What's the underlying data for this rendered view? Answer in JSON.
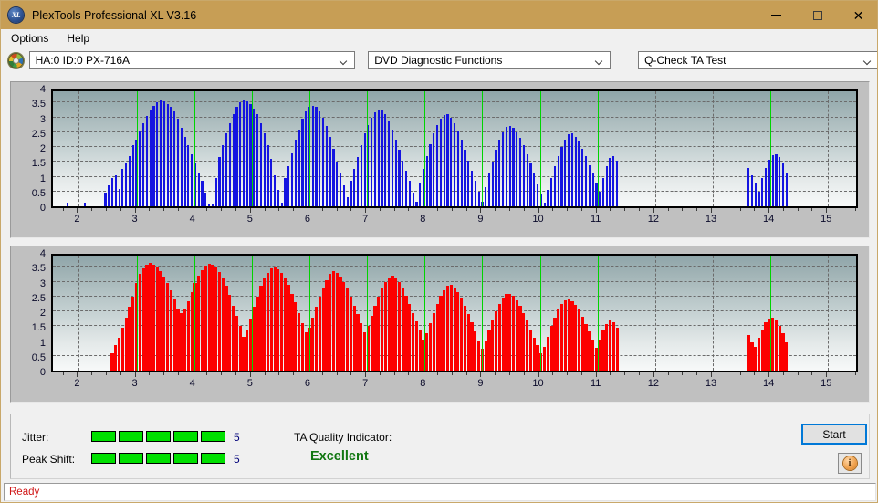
{
  "window": {
    "title": "PlexTools Professional XL V3.16",
    "icon": "xl-disc-icon",
    "icon_text": "XL",
    "controls": {
      "minimize": "minimize-icon",
      "maximize": "maximize-icon",
      "close": "close-icon"
    }
  },
  "menubar": {
    "items": [
      {
        "label": "Options"
      },
      {
        "label": "Help"
      }
    ]
  },
  "toolbar": {
    "drive_icon": "disc-icon",
    "drive_select": "HA:0 ID:0  PX-716A",
    "function_select": "DVD Diagnostic Functions",
    "test_select": "Q-Check TA Test"
  },
  "chart_data": [
    {
      "type": "bar",
      "title": "",
      "name": "ta-test-upper-blue",
      "series_color": "#1414e0",
      "background_top": "#8fa5a9",
      "background_bottom": "#f7f9f9",
      "marker_color": "#00d400",
      "grid": true,
      "legend": "none",
      "xlabel": "",
      "ylabel": "",
      "xlim": [
        1.55,
        15.55
      ],
      "ylim": [
        0,
        4
      ],
      "xticks": [
        2,
        3,
        4,
        5,
        6,
        7,
        8,
        9,
        10,
        11,
        12,
        13,
        14,
        15
      ],
      "yticks": [
        0,
        0.5,
        1,
        1.5,
        2,
        2.5,
        3,
        3.5,
        4
      ],
      "markers_x": [
        3,
        4,
        5,
        6,
        7,
        8,
        9,
        10,
        11,
        14
      ],
      "x": [
        1.8,
        1.86,
        1.92,
        1.98,
        2.04,
        2.1,
        2.16,
        2.22,
        2.28,
        2.34,
        2.4,
        2.46,
        2.52,
        2.58,
        2.64,
        2.7,
        2.76,
        2.82,
        2.88,
        2.94,
        3.0,
        3.06,
        3.12,
        3.18,
        3.24,
        3.3,
        3.36,
        3.42,
        3.48,
        3.54,
        3.6,
        3.66,
        3.72,
        3.78,
        3.84,
        3.9,
        3.96,
        4.02,
        4.08,
        4.14,
        4.2,
        4.26,
        4.32,
        4.38,
        4.44,
        4.5,
        4.56,
        4.62,
        4.68,
        4.74,
        4.8,
        4.86,
        4.92,
        4.98,
        5.04,
        5.1,
        5.16,
        5.22,
        5.28,
        5.34,
        5.4,
        5.46,
        5.52,
        5.58,
        5.64,
        5.7,
        5.76,
        5.82,
        5.88,
        5.94,
        6.0,
        6.06,
        6.12,
        6.18,
        6.24,
        6.3,
        6.36,
        6.42,
        6.48,
        6.54,
        6.6,
        6.66,
        6.72,
        6.78,
        6.84,
        6.9,
        6.96,
        7.02,
        7.08,
        7.14,
        7.2,
        7.26,
        7.32,
        7.38,
        7.44,
        7.5,
        7.56,
        7.62,
        7.68,
        7.74,
        7.8,
        7.86,
        7.92,
        7.98,
        8.04,
        8.1,
        8.16,
        8.22,
        8.28,
        8.34,
        8.4,
        8.46,
        8.52,
        8.58,
        8.64,
        8.7,
        8.76,
        8.82,
        8.88,
        8.94,
        9.0,
        9.06,
        9.12,
        9.18,
        9.24,
        9.3,
        9.36,
        9.42,
        9.48,
        9.54,
        9.6,
        9.66,
        9.72,
        9.78,
        9.84,
        9.9,
        9.96,
        10.02,
        10.08,
        10.14,
        10.2,
        10.26,
        10.32,
        10.38,
        10.44,
        10.5,
        10.56,
        10.62,
        10.68,
        10.74,
        10.8,
        10.86,
        10.92,
        10.98,
        11.04,
        11.1,
        11.16,
        11.22,
        11.28,
        11.34,
        13.62,
        13.68,
        13.74,
        13.8,
        13.86,
        13.92,
        13.98,
        14.04,
        14.1,
        14.16,
        14.22,
        14.28
      ],
      "values": [
        0.12,
        0,
        0,
        0,
        0,
        0.12,
        0,
        0,
        0,
        0,
        0,
        0.45,
        0.7,
        0.95,
        1.05,
        0.6,
        1.25,
        1.45,
        1.7,
        2.05,
        2.25,
        2.55,
        2.8,
        3.05,
        3.25,
        3.4,
        3.52,
        3.56,
        3.55,
        3.45,
        3.35,
        3.2,
        2.95,
        2.65,
        2.35,
        2.05,
        1.75,
        1.45,
        1.15,
        0.85,
        0.45,
        0.1,
        0.05,
        0.95,
        1.65,
        2.05,
        2.45,
        2.8,
        3.1,
        3.35,
        3.5,
        3.58,
        3.55,
        3.45,
        3.3,
        3.1,
        2.8,
        2.45,
        2.05,
        1.6,
        1.05,
        0.55,
        0.12,
        0.95,
        1.35,
        1.8,
        2.25,
        2.6,
        2.95,
        3.2,
        3.35,
        3.4,
        3.35,
        3.2,
        3.0,
        2.7,
        2.35,
        1.95,
        1.5,
        1.1,
        0.7,
        0.3,
        0.85,
        1.25,
        1.65,
        2.05,
        2.45,
        2.75,
        3.0,
        3.18,
        3.25,
        3.22,
        3.1,
        2.9,
        2.6,
        2.25,
        1.9,
        1.55,
        1.2,
        0.85,
        0.45,
        0.15,
        0.8,
        1.25,
        1.7,
        2.1,
        2.45,
        2.75,
        2.95,
        3.08,
        3.1,
        3.0,
        2.8,
        2.55,
        2.25,
        1.9,
        1.55,
        1.2,
        0.85,
        0.5,
        0.15,
        0.65,
        1.1,
        1.5,
        1.9,
        2.25,
        2.5,
        2.68,
        2.72,
        2.65,
        2.5,
        2.3,
        2.05,
        1.75,
        1.45,
        1.1,
        0.75,
        0.4,
        0.12,
        0.55,
        0.95,
        1.35,
        1.7,
        2.0,
        2.25,
        2.42,
        2.45,
        2.35,
        2.2,
        1.95,
        1.7,
        1.4,
        1.1,
        0.8,
        0.5,
        0.95,
        1.35,
        1.62,
        1.7,
        1.55,
        1.3,
        1.05,
        0.8,
        0.5,
        0.95,
        1.3,
        1.58,
        1.72,
        1.76,
        1.65,
        1.45,
        1.1
      ]
    },
    {
      "type": "bar",
      "title": "",
      "name": "ta-test-lower-red",
      "series_color": "#fc0000",
      "background_top": "#8fa5a9",
      "background_bottom": "#f7f9f9",
      "marker_color": "#00d400",
      "grid": true,
      "legend": "none",
      "xlabel": "",
      "ylabel": "",
      "xlim": [
        1.55,
        15.55
      ],
      "ylim": [
        0,
        4
      ],
      "xticks": [
        2,
        3,
        4,
        5,
        6,
        7,
        8,
        9,
        10,
        11,
        12,
        13,
        14,
        15
      ],
      "yticks": [
        0,
        0.5,
        1,
        1.5,
        2,
        2.5,
        3,
        3.5,
        4
      ],
      "markers_x": [
        3,
        4,
        5,
        6,
        7,
        8,
        9,
        10,
        11,
        14
      ],
      "x": [
        2.58,
        2.64,
        2.7,
        2.76,
        2.82,
        2.88,
        2.94,
        3.0,
        3.06,
        3.12,
        3.18,
        3.24,
        3.3,
        3.36,
        3.42,
        3.48,
        3.54,
        3.6,
        3.66,
        3.72,
        3.78,
        3.84,
        3.9,
        3.96,
        4.02,
        4.08,
        4.14,
        4.2,
        4.26,
        4.32,
        4.38,
        4.44,
        4.5,
        4.56,
        4.62,
        4.68,
        4.74,
        4.8,
        4.86,
        4.92,
        4.98,
        5.04,
        5.1,
        5.16,
        5.22,
        5.28,
        5.34,
        5.4,
        5.46,
        5.52,
        5.58,
        5.64,
        5.7,
        5.76,
        5.82,
        5.88,
        5.94,
        6.0,
        6.06,
        6.12,
        6.18,
        6.24,
        6.3,
        6.36,
        6.42,
        6.48,
        6.54,
        6.6,
        6.66,
        6.72,
        6.78,
        6.84,
        6.9,
        6.96,
        7.02,
        7.08,
        7.14,
        7.2,
        7.26,
        7.32,
        7.38,
        7.44,
        7.5,
        7.56,
        7.62,
        7.68,
        7.74,
        7.8,
        7.86,
        7.92,
        7.98,
        8.04,
        8.1,
        8.16,
        8.22,
        8.28,
        8.34,
        8.4,
        8.46,
        8.52,
        8.58,
        8.64,
        8.7,
        8.76,
        8.82,
        8.88,
        8.94,
        9.0,
        9.06,
        9.12,
        9.18,
        9.24,
        9.3,
        9.36,
        9.42,
        9.48,
        9.54,
        9.6,
        9.66,
        9.72,
        9.78,
        9.84,
        9.9,
        9.96,
        10.02,
        10.08,
        10.14,
        10.2,
        10.26,
        10.32,
        10.38,
        10.44,
        10.5,
        10.56,
        10.62,
        10.68,
        10.74,
        10.8,
        10.86,
        10.92,
        10.98,
        11.04,
        11.1,
        11.16,
        11.22,
        11.28,
        11.34,
        13.62,
        13.68,
        13.74,
        13.8,
        13.86,
        13.92,
        13.98,
        14.04,
        14.1,
        14.16,
        14.22,
        14.28
      ],
      "values": [
        0.6,
        0.85,
        1.1,
        1.45,
        1.8,
        2.15,
        2.5,
        2.95,
        3.25,
        3.45,
        3.58,
        3.62,
        3.58,
        3.48,
        3.35,
        3.18,
        2.95,
        2.7,
        2.4,
        2.1,
        1.95,
        2.1,
        2.35,
        2.65,
        2.95,
        3.2,
        3.4,
        3.55,
        3.6,
        3.58,
        3.48,
        3.32,
        3.1,
        2.85,
        2.55,
        2.2,
        1.85,
        1.5,
        1.15,
        1.35,
        1.75,
        2.15,
        2.5,
        2.85,
        3.1,
        3.3,
        3.45,
        3.48,
        3.42,
        3.3,
        3.12,
        2.88,
        2.6,
        2.3,
        1.95,
        1.6,
        1.3,
        1.45,
        1.8,
        2.15,
        2.5,
        2.8,
        3.05,
        3.25,
        3.35,
        3.3,
        3.18,
        3.0,
        2.78,
        2.5,
        2.2,
        1.9,
        1.6,
        1.3,
        1.5,
        1.85,
        2.2,
        2.5,
        2.78,
        3.0,
        3.15,
        3.2,
        3.12,
        2.98,
        2.78,
        2.52,
        2.25,
        1.95,
        1.65,
        1.35,
        1.05,
        1.25,
        1.6,
        1.95,
        2.25,
        2.52,
        2.72,
        2.85,
        2.88,
        2.8,
        2.65,
        2.45,
        2.2,
        1.92,
        1.62,
        1.32,
        1.02,
        0.75,
        1.0,
        1.35,
        1.7,
        2.0,
        2.25,
        2.45,
        2.58,
        2.6,
        2.52,
        2.38,
        2.18,
        1.95,
        1.68,
        1.4,
        1.12,
        0.85,
        0.58,
        0.8,
        1.15,
        1.5,
        1.8,
        2.05,
        2.25,
        2.38,
        2.42,
        2.35,
        2.22,
        2.05,
        1.82,
        1.58,
        1.32,
        1.05,
        0.78,
        1.05,
        1.35,
        1.58,
        1.68,
        1.62,
        1.45,
        1.2,
        0.95,
        0.8,
        1.1,
        1.4,
        1.62,
        1.75,
        1.78,
        1.7,
        1.52,
        1.25,
        0.95
      ]
    }
  ],
  "results": {
    "jitter_label": "Jitter:",
    "jitter_value": "5",
    "jitter_segments": 5,
    "peak_shift_label": "Peak Shift:",
    "peak_shift_value": "5",
    "peak_shift_segments": 5,
    "ta_quality_label": "TA Quality Indicator:",
    "ta_quality_value": "Excellent",
    "ta_quality_color": "#117711",
    "meter_color": "#00e000"
  },
  "actions": {
    "start_label": "Start",
    "info_icon": "info-icon",
    "info_glyph": "i"
  },
  "statusbar": {
    "text": "Ready",
    "color": "#d01818"
  }
}
